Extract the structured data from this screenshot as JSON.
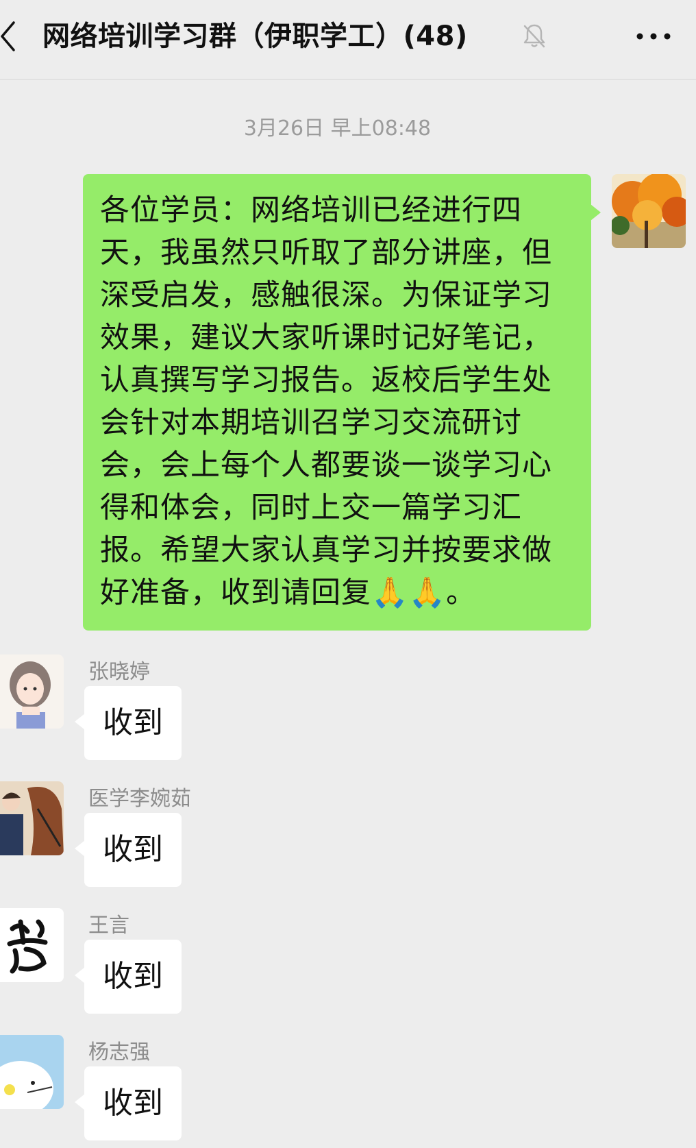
{
  "header": {
    "title": "网络培训学习群（伊职学工）(48)",
    "back_icon": "chevron-left-icon",
    "mute_icon": "bell-slash-icon",
    "more_icon": "more-dots-icon"
  },
  "timestamp": "3月26日 早上08:48",
  "self_message": {
    "text": "各位学员：网络培训已经进行四天，我虽然只听取了部分讲座，但深受启发，感触很深。为保证学习效果，建议大家听课时记好笔记，认真撰写学习报告。返校后学生处会针对本期培训召学习交流研讨会，会上每个人都要谈一谈学习心得和体会，同时上交一篇学习汇报。希望大家认真学习并按要求做好准备，收到请回复🙏🙏。",
    "bubble_color": "#95ec69"
  },
  "messages": [
    {
      "sender": "张晓婷",
      "text": "收到"
    },
    {
      "sender": "医学李婉茹",
      "text": "收到"
    },
    {
      "sender": "王言",
      "text": "收到"
    },
    {
      "sender": "杨志强",
      "text": "收到"
    }
  ],
  "colors": {
    "background": "#ededed",
    "incoming_bubble": "#ffffff",
    "meta_text": "#9b9b9b"
  }
}
